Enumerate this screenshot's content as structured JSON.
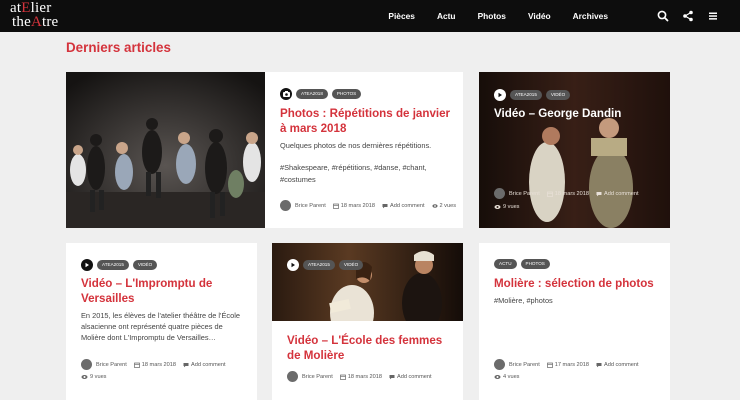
{
  "logo": {
    "line1_a": "at",
    "line1_b": "E",
    "line1_c": "lier",
    "line2_a": "the",
    "line2_b": "A",
    "line2_c": "tre"
  },
  "nav": {
    "items": [
      "Pièces",
      "Actu",
      "Photos",
      "Vidéo",
      "Archives"
    ]
  },
  "icons": {
    "search": "search-icon",
    "share": "share-icon",
    "menu": "hamburger-icon"
  },
  "colors": {
    "accent": "#d4333c",
    "nav_bg": "#0d0d0d",
    "page_bg": "#efefef"
  },
  "section_title": "Derniers articles",
  "cards": [
    {
      "badges": [
        "ATEA2018",
        "PHOTOS"
      ],
      "title": "Photos : Répétitions de janvier à mars 2018",
      "excerpt": "Quelques photos de nos dernières répétitions.",
      "tags": "#Shakespeare, #répétitions, #danse, #chant, #costumes",
      "author": "Brice Parent",
      "date": "18 mars 2018",
      "comment": "Add comment",
      "views": "2 vues"
    },
    {
      "badges": [
        "ATEA2015",
        "VIDÉO"
      ],
      "title": "Vidéo – George Dandin",
      "author": "Brice Parent",
      "date": "18 mars 2018",
      "comment": "Add comment",
      "views": "9 vues"
    },
    {
      "badges": [
        "ATEA2015",
        "VIDÉO"
      ],
      "title": "Vidéo – L'Impromptu de Versailles",
      "excerpt": "En 2015, les élèves de l'atelier théâtre de l'École alsacienne ont représenté quatre pièces de Molière dont L'Impromptu de Versailles…",
      "author": "Brice Parent",
      "date": "18 mars 2018",
      "comment": "Add comment",
      "views": "9 vues"
    },
    {
      "badges": [
        "ATEA2015",
        "VIDÉO"
      ],
      "title": "Vidéo – L'École des femmes de Molière",
      "author": "Brice Parent",
      "date": "18 mars 2018",
      "comment": "Add comment"
    },
    {
      "badges": [
        "ACTU",
        "PHOTOS"
      ],
      "title": "Molière : sélection de photos",
      "tags": "#Molière, #photos",
      "author": "Brice Parent",
      "date": "17 mars 2018",
      "comment": "Add comment",
      "views": "4 vues"
    }
  ]
}
